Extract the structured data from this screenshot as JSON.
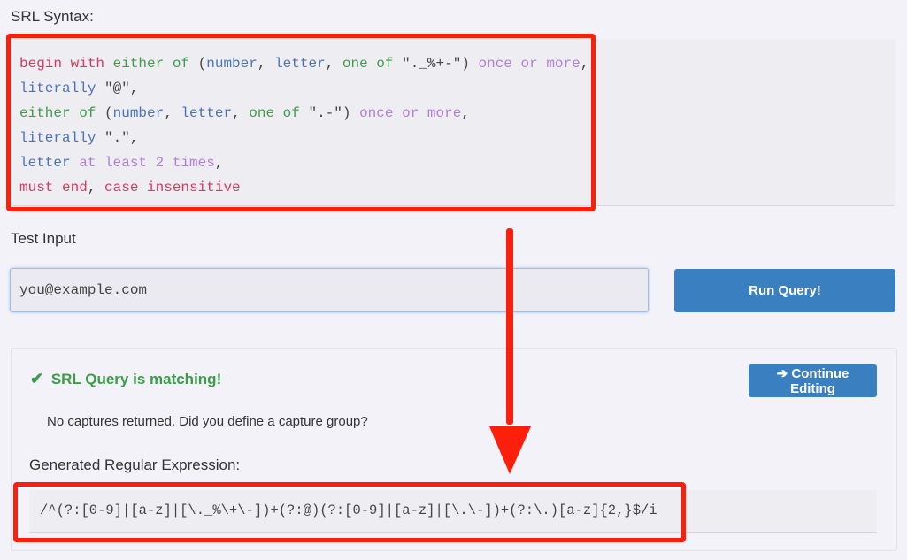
{
  "srl_section": {
    "label": "SRL Syntax:",
    "lines": [
      [
        {
          "t": "begin with",
          "c": "kw-red"
        },
        {
          "t": " ",
          "c": "kw-plain"
        },
        {
          "t": "either of",
          "c": "kw-green"
        },
        {
          "t": " (",
          "c": "kw-plain"
        },
        {
          "t": "number",
          "c": "kw-blue"
        },
        {
          "t": ", ",
          "c": "kw-plain"
        },
        {
          "t": "letter",
          "c": "kw-blue"
        },
        {
          "t": ", ",
          "c": "kw-plain"
        },
        {
          "t": "one of",
          "c": "kw-green"
        },
        {
          "t": " \"._%+-\") ",
          "c": "kw-plain"
        },
        {
          "t": "once or more",
          "c": "kw-purple"
        },
        {
          "t": ",",
          "c": "kw-plain"
        }
      ],
      [
        {
          "t": "literally",
          "c": "kw-blue"
        },
        {
          "t": " \"@\",",
          "c": "kw-plain"
        }
      ],
      [
        {
          "t": "either of",
          "c": "kw-green"
        },
        {
          "t": " (",
          "c": "kw-plain"
        },
        {
          "t": "number",
          "c": "kw-blue"
        },
        {
          "t": ", ",
          "c": "kw-plain"
        },
        {
          "t": "letter",
          "c": "kw-blue"
        },
        {
          "t": ", ",
          "c": "kw-plain"
        },
        {
          "t": "one of",
          "c": "kw-green"
        },
        {
          "t": " \".-\") ",
          "c": "kw-plain"
        },
        {
          "t": "once or more",
          "c": "kw-purple"
        },
        {
          "t": ",",
          "c": "kw-plain"
        }
      ],
      [
        {
          "t": "literally",
          "c": "kw-blue"
        },
        {
          "t": " \".\",",
          "c": "kw-plain"
        }
      ],
      [
        {
          "t": "letter",
          "c": "kw-blue"
        },
        {
          "t": " ",
          "c": "kw-plain"
        },
        {
          "t": "at least 2 times",
          "c": "kw-purple"
        },
        {
          "t": ",",
          "c": "kw-plain"
        }
      ],
      [
        {
          "t": "must end",
          "c": "kw-red"
        },
        {
          "t": ", ",
          "c": "kw-plain"
        },
        {
          "t": "case insensitive",
          "c": "kw-red"
        }
      ]
    ]
  },
  "test_section": {
    "label": "Test Input",
    "input_value": "you@example.com",
    "run_button": "Run Query!"
  },
  "result": {
    "status_icon": "check-icon",
    "status_text": "SRL Query is matching!",
    "continue_button": "Continue Editing",
    "captures_message": "No captures returned. Did you define a capture group?",
    "regex_label": "Generated Regular Expression:",
    "regex": "/^(?:[0-9]|[a-z]|[\\._%\\+\\-])+(?:@)(?:[0-9]|[a-z]|[\\.\\-])+(?:\\.)[a-z]{2,}$/i"
  },
  "colors": {
    "annotation_red": "#fb1f0c",
    "button_blue": "#3a7fc0",
    "success_green": "#3a9d4a"
  }
}
